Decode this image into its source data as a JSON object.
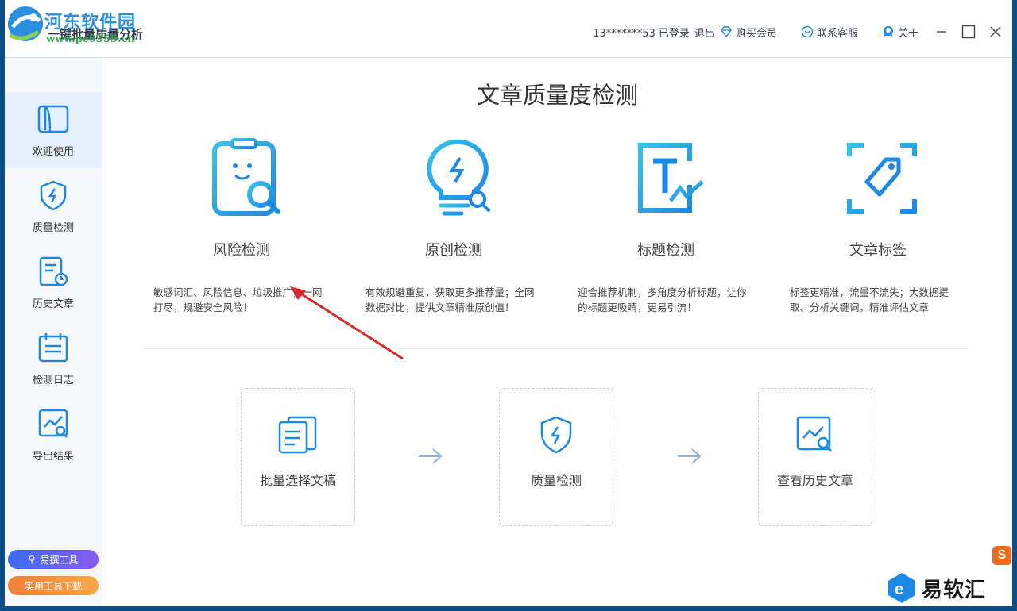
{
  "titlebar": {
    "watermark": "河东软件园",
    "watermark_url": "www.pc0359.cn",
    "app_title": "一键批量质量分析",
    "account": "13*******53 已登录",
    "logout": "退出",
    "buy_member": "购买会员",
    "contact_service": "联系客服",
    "about": "关于"
  },
  "sidebar": {
    "items": [
      {
        "label": "欢迎使用",
        "icon": "book-icon",
        "active": true
      },
      {
        "label": "质量检测",
        "icon": "shield-bolt-icon",
        "active": false
      },
      {
        "label": "历史文章",
        "icon": "document-clock-icon",
        "active": false
      },
      {
        "label": "检测日志",
        "icon": "calendar-list-icon",
        "active": false
      },
      {
        "label": "导出结果",
        "icon": "chart-search-icon",
        "active": false
      }
    ],
    "promo1": "易撰工具",
    "promo2": "实用工具下载"
  },
  "main": {
    "title": "文章质量度检测",
    "features": [
      {
        "name": "风险检测",
        "desc": "敏感词汇、风险信息、垃圾推广，一网打尽，规避安全风险！",
        "icon": "risk-detect-icon"
      },
      {
        "name": "原创检测",
        "desc": "有效规避重复，获取更多推荐量；全网数据对比，提供文章精准原创值！",
        "icon": "lightbulb-icon"
      },
      {
        "name": "标题检测",
        "desc": "迎合推荐机制，多角度分析标题，让你的标题更吸睛，更易引流！",
        "icon": "title-t-icon"
      },
      {
        "name": "文章标签",
        "desc": "标签更精准，流量不流失；大数据提取、分析关键词，精准评估文章",
        "icon": "tag-scan-icon"
      }
    ],
    "steps": [
      {
        "label": "批量选择文稿",
        "icon": "documents-icon"
      },
      {
        "label": "质量检测",
        "icon": "shield-bolt-icon"
      },
      {
        "label": "查看历史文章",
        "icon": "chart-search-icon"
      }
    ]
  },
  "brand": {
    "text": "易软汇"
  },
  "colors": {
    "accent": "#1e9bf0",
    "accent2": "#35c3e8",
    "title_text": "#333333"
  }
}
